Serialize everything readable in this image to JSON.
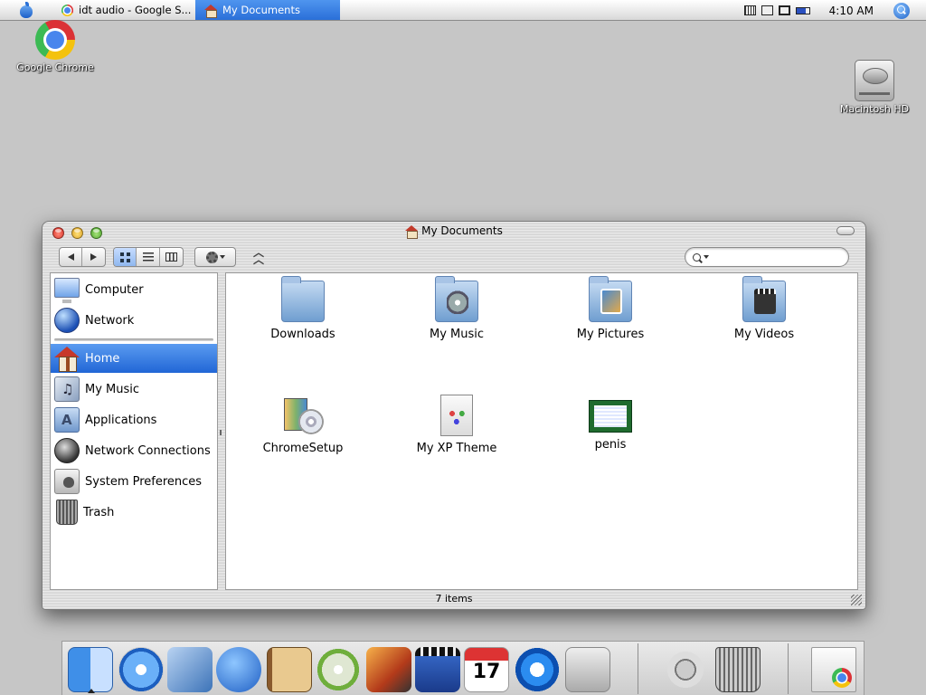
{
  "menubar": {
    "tasks": [
      {
        "label": "idt audio - Google S...",
        "icon": "chrome-icon",
        "active": false
      },
      {
        "label": "My Documents",
        "icon": "home-icon",
        "active": true
      }
    ],
    "tray_icons": [
      "keyboard-icon",
      "display-icon",
      "network-icon",
      "battery-icon"
    ],
    "clock": "4:10 AM"
  },
  "desktop": {
    "icons": [
      {
        "label": "Google Chrome",
        "icon": "chrome-icon"
      },
      {
        "label": "Macintosh HD",
        "icon": "hard-drive-icon"
      }
    ]
  },
  "window": {
    "title": "My Documents",
    "search_placeholder": "",
    "status": "7 items",
    "sidebar": {
      "devices": [
        {
          "label": "Computer",
          "icon": "computer-icon"
        },
        {
          "label": "Network",
          "icon": "network-globe-icon"
        }
      ],
      "places": [
        {
          "label": "Home",
          "icon": "home-icon",
          "selected": true
        },
        {
          "label": "My Music",
          "icon": "music-folder-icon",
          "selected": false
        },
        {
          "label": "Applications",
          "icon": "applications-icon",
          "selected": false
        },
        {
          "label": "Network Connections",
          "icon": "network-connections-icon",
          "selected": false
        },
        {
          "label": "System Preferences",
          "icon": "system-preferences-icon",
          "selected": false
        },
        {
          "label": "Trash",
          "icon": "trash-icon",
          "selected": false
        }
      ]
    },
    "items": [
      {
        "label": "Downloads",
        "icon": "folder-icon"
      },
      {
        "label": "My Music",
        "icon": "music-folder-icon"
      },
      {
        "label": "My Pictures",
        "icon": "pictures-folder-icon"
      },
      {
        "label": "My Videos",
        "icon": "videos-folder-icon"
      },
      {
        "label": "ChromeSetup",
        "icon": "installer-icon"
      },
      {
        "label": "My XP Theme",
        "icon": "theme-document-icon"
      },
      {
        "label": "penis",
        "icon": "certificate-icon"
      }
    ]
  },
  "dock": {
    "items": [
      {
        "name": "finder-icon"
      },
      {
        "name": "safari-icon"
      },
      {
        "name": "mail-icon"
      },
      {
        "name": "ichat-icon"
      },
      {
        "name": "address-book-icon"
      },
      {
        "name": "itunes-icon"
      },
      {
        "name": "iphoto-icon"
      },
      {
        "name": "imovie-icon"
      },
      {
        "name": "ical-icon",
        "month": "JUL",
        "day": "17"
      },
      {
        "name": "quicktime-icon"
      },
      {
        "name": "system-preferences-icon"
      },
      {
        "name": "internet-connect-icon"
      },
      {
        "name": "trash-icon"
      },
      {
        "name": "minimized-window-icon"
      }
    ]
  }
}
